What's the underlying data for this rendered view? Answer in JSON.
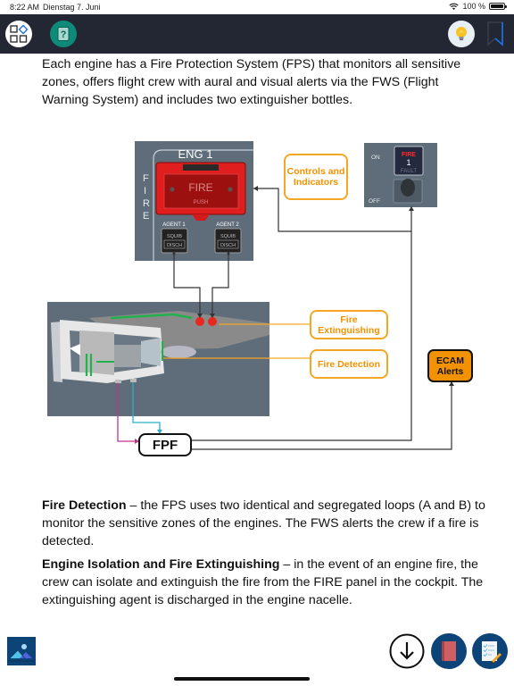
{
  "status_bar": {
    "time": "8:22 AM",
    "date": "Dienstag 7. Juni",
    "battery": "100 %",
    "battery_level": 1.0,
    "icons": [
      "wifi-icon",
      "battery-icon"
    ]
  },
  "toolbar": {
    "buttons": [
      {
        "name": "menu",
        "icon": "grid-diamond-icon"
      },
      {
        "name": "help",
        "icon": "question-card-icon"
      },
      {
        "name": "tip",
        "icon": "lightbulb-icon"
      },
      {
        "name": "bookmark",
        "icon": "bookmark-icon"
      }
    ]
  },
  "content": {
    "intro": "Each engine has a Fire Protection System (FPS) that monitors all sensitive zones, offers flight crew with aural and visual alerts via the FWS (Flight Warning System) and includes two extinguisher bottles.",
    "detection_title": "Fire Detection",
    "detection_text": " – the FPS uses two identical and segregated loops  (A and B) to monitor the sensitive zones of the engines. The FWS alerts the crew if a fire is detected.",
    "isolation_title": "Engine Isolation and Fire Extinguishing",
    "isolation_text": " – in the event of an engine fire, the crew can isolate and extinguish the fire from the FIRE panel in the cockpit. The extinguishing agent is discharged in the engine nacelle."
  },
  "diagram": {
    "fire_panel": {
      "title": "ENG 1",
      "side_label": "FIRE",
      "button_label": "FIRE",
      "button_sublabel": "PUSH",
      "agent1": "AGENT 1",
      "agent2": "AGENT 2",
      "squib": "SQUIB",
      "disch": "DISCH"
    },
    "master_switch": {
      "on": "ON",
      "off": "OFF",
      "fire": "FIRE",
      "number": "1",
      "fault": "FAULT"
    },
    "labels": {
      "controls": "Controls and Indicators",
      "extinguishing": "Fire Extinguishing",
      "detection": "Fire Detection",
      "ecam": "ECAM Alerts",
      "fpf": "FPF"
    },
    "colors": {
      "label_orange": "#f39200",
      "loop_a": "#c2338a",
      "loop_b": "#2ab0c6",
      "detector_green": "#22b14c",
      "bottle_red": "#e8281e"
    }
  },
  "bottom_bar": {
    "buttons": [
      {
        "name": "image-gallery",
        "icon": "image-icon"
      },
      {
        "name": "download",
        "icon": "arrow-down-circle-icon"
      },
      {
        "name": "manual",
        "icon": "book-icon"
      },
      {
        "name": "notes",
        "icon": "checklist-pencil-icon"
      }
    ]
  }
}
